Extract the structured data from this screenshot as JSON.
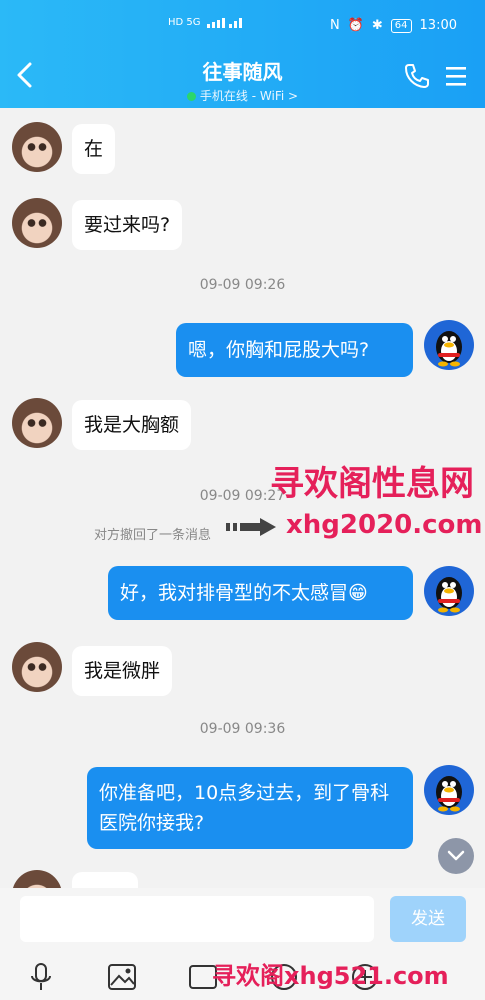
{
  "status_bar": {
    "left_indicators": "HD 5G",
    "time": "13:00",
    "battery": "64"
  },
  "header": {
    "title": "往事随风",
    "subtitle": "手机在线 - WiFi >"
  },
  "messages": [
    {
      "side": "in",
      "text": "在"
    },
    {
      "side": "in",
      "text": "要过来吗?"
    },
    {
      "type": "time",
      "text": "09-09 09:26"
    },
    {
      "side": "out",
      "text": "嗯，你胸和屁股大吗?"
    },
    {
      "side": "in",
      "text": "我是大胸额"
    },
    {
      "type": "time",
      "text": "09-09 09:27"
    },
    {
      "type": "system",
      "text": "对方撤回了一条消息"
    },
    {
      "side": "out",
      "text": "好，我对排骨型的不太感冒😁"
    },
    {
      "side": "in",
      "text": "我是微胖"
    },
    {
      "type": "time",
      "text": "09-09 09:36"
    },
    {
      "side": "out",
      "text": "你准备吧，10点多过去，到了骨科医院你接我?"
    }
  ],
  "watermarks": {
    "w1": "寻欢阁性息网",
    "w2": "xhg2020.com",
    "w3": "寻欢阁xhg521.com"
  },
  "composer": {
    "send_label": "发送"
  },
  "colors": {
    "header_start": "#2bb9f7",
    "header_end": "#1aa0f5",
    "outgoing_bubble": "#1a8ff0",
    "send_disabled": "#9fd3fb",
    "watermark": "#e5205a"
  },
  "icons": [
    "back-icon",
    "phone-icon",
    "menu-icon",
    "mic-icon",
    "image-icon",
    "gif-icon",
    "emoji-icon",
    "plus-icon",
    "chevron-down-icon"
  ]
}
